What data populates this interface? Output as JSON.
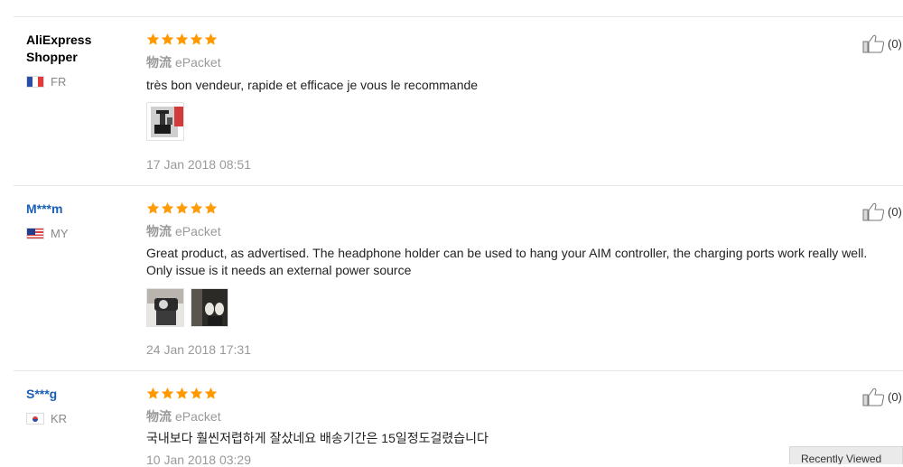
{
  "star_color": "#ff9a00",
  "reviews": [
    {
      "author": "AliExpress Shopper",
      "country": "FR",
      "rating": 5,
      "shipping_label": "物流",
      "shipping": "ePacket",
      "text": "très bon vendeur, rapide et efficace je vous le recommande",
      "date": "17 Jan 2018 08:51",
      "likes": "(0)"
    },
    {
      "author": "M***m",
      "country": "MY",
      "rating": 5,
      "shipping_label": "物流",
      "shipping": "ePacket",
      "text_line1": "Great product, as advertised. The headphone holder can be used to hang your AIM controller, the charging ports work really well.",
      "text_line2": "Only issue is it needs an external power source",
      "date": "24 Jan 2018 17:31",
      "likes": "(0)"
    },
    {
      "author": "S***g",
      "country": "KR",
      "rating": 5,
      "shipping_label": "物流",
      "shipping": "ePacket",
      "text": "국내보다 훨씬저렵하게 잘샀네요 배송기간은 15일정도걸렸습니다",
      "date": "10 Jan 2018 03:29",
      "likes": "(0)"
    }
  ],
  "floating_button": "Recently Viewed"
}
